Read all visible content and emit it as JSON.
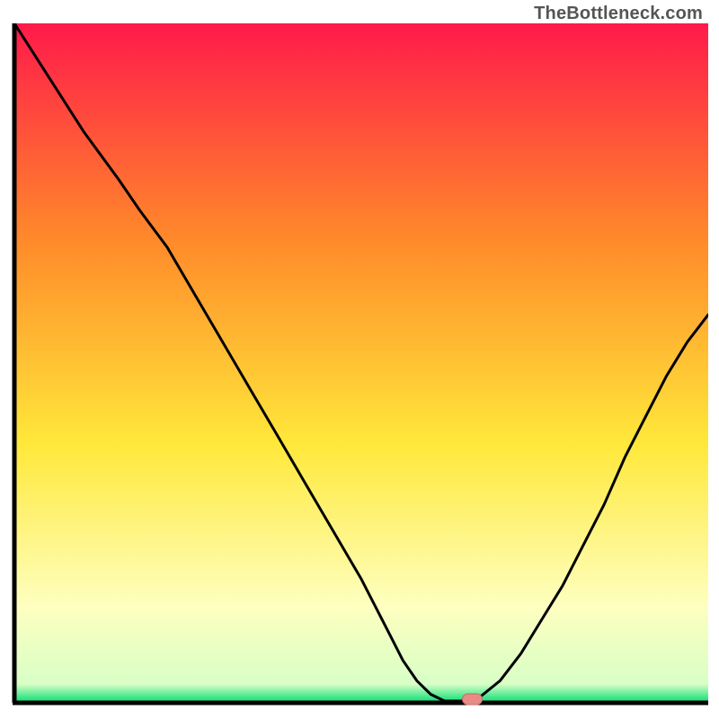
{
  "watermark": "TheBottleneck.com",
  "colors": {
    "gradient_top": "#ff1a4a",
    "gradient_mid_orange": "#ff8a2a",
    "gradient_yellow": "#ffe83a",
    "gradient_pale_yellow": "#feffbf",
    "gradient_green": "#16e07a",
    "axis": "#000000",
    "curve": "#000000",
    "marker_fill": "#e78b84",
    "marker_stroke": "#c96a63"
  },
  "chart_data": {
    "type": "line",
    "title": "",
    "xlabel": "",
    "ylabel": "",
    "xlim": [
      0,
      100
    ],
    "ylim": [
      0,
      100
    ],
    "x": [
      0,
      5,
      10,
      15,
      18,
      22,
      26,
      30,
      34,
      38,
      42,
      46,
      50,
      54,
      56,
      58,
      60,
      62,
      65,
      67,
      70,
      73,
      76,
      79,
      82,
      85,
      88,
      91,
      94,
      97,
      100
    ],
    "values": [
      100,
      92,
      84,
      77,
      72.5,
      67,
      60,
      53,
      46,
      39,
      32,
      25,
      18,
      10,
      6,
      3,
      1,
      0,
      0,
      0.5,
      3,
      7,
      12,
      17,
      23,
      29,
      36,
      42,
      48,
      53,
      57
    ],
    "marker": {
      "x": 66,
      "y": 0
    },
    "annotations": []
  }
}
